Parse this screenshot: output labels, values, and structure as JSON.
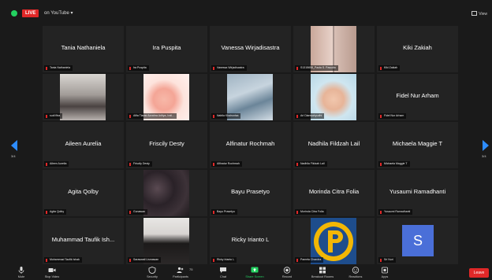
{
  "topbar": {
    "live_label": "LIVE",
    "stream_label": "on YouTube ▾",
    "view_label": "View"
  },
  "tiles": [
    {
      "name": "Tania Nathaniela",
      "label": "Tania Nathaniela"
    },
    {
      "name": "Ira Puspita",
      "label": "Ira Puspita"
    },
    {
      "name": "Vanessa Wirjadisastra",
      "label": "Vanessa Wirjadisastra"
    },
    {
      "name": "",
      "label": "S1315658_Paola S. Pasudia"
    },
    {
      "name": "Kiki Zakiah",
      "label": "Kiki Zakiah"
    },
    {
      "name": "",
      "label": "sudi fitra"
    },
    {
      "name": "",
      "label": "Alfia Tiaras Azzahra Aditya, Irali..."
    },
    {
      "name": "",
      "label": "Nabila Khairunisa"
    },
    {
      "name": "",
      "label": "Ari Dianwahyudhi"
    },
    {
      "name": "Fidel Nur Arham",
      "label": "Fidel Nur Arham"
    },
    {
      "name": "Aileen Aurelia",
      "label": "Aileen Aurelia"
    },
    {
      "name": "Friscily Desty",
      "label": "Friscily Desty"
    },
    {
      "name": "Alfinatur Rochmah",
      "label": "Alfinatur Rochmah"
    },
    {
      "name": "Nadhila Fildzah Lail",
      "label": "Nadhila Fildzah Lail"
    },
    {
      "name": "Michaela Maggie T",
      "label": "Michaela Maggie T"
    },
    {
      "name": "Agita Qolby",
      "label": "Agita Qolby"
    },
    {
      "name": "",
      "label": "Gunawan"
    },
    {
      "name": "Bayu Prasetyo",
      "label": "Bayu Prasetyo"
    },
    {
      "name": "Morinda Citra Folia",
      "label": "Morinda Citra Folia"
    },
    {
      "name": "Yusaumi Ramadhanti",
      "label": "Yusaumi Ramadhanti"
    },
    {
      "name": "Muhammad Taufik Ish...",
      "label": "Muhammad Taufik Ishak"
    },
    {
      "name": "",
      "label": "Saraswati Lismawan"
    },
    {
      "name": "Ricky Irianto L",
      "label": "Ricky Irianto L"
    },
    {
      "name": "",
      "label": "Pamela Chandra"
    },
    {
      "name": "",
      "label": "Sri Nuri"
    }
  ],
  "avatar_letter": "S",
  "pages": {
    "left": "3/4",
    "right": "3/4"
  },
  "toolbar": {
    "mute": "Mute",
    "stop_video": "Stop Video",
    "security": "Security",
    "participants": "Participants",
    "participants_count": "75",
    "chat": "Chat",
    "share_screen": "Share Screen",
    "record": "Record",
    "breakout_rooms": "Breakout Rooms",
    "reactions": "Reactions",
    "apps": "Apps",
    "leave": "Leave"
  },
  "colors": {
    "accent": "#2d8cff",
    "live_red": "#e02828",
    "share_green": "#23d160",
    "avatar_blue": "#4a6fd8"
  }
}
